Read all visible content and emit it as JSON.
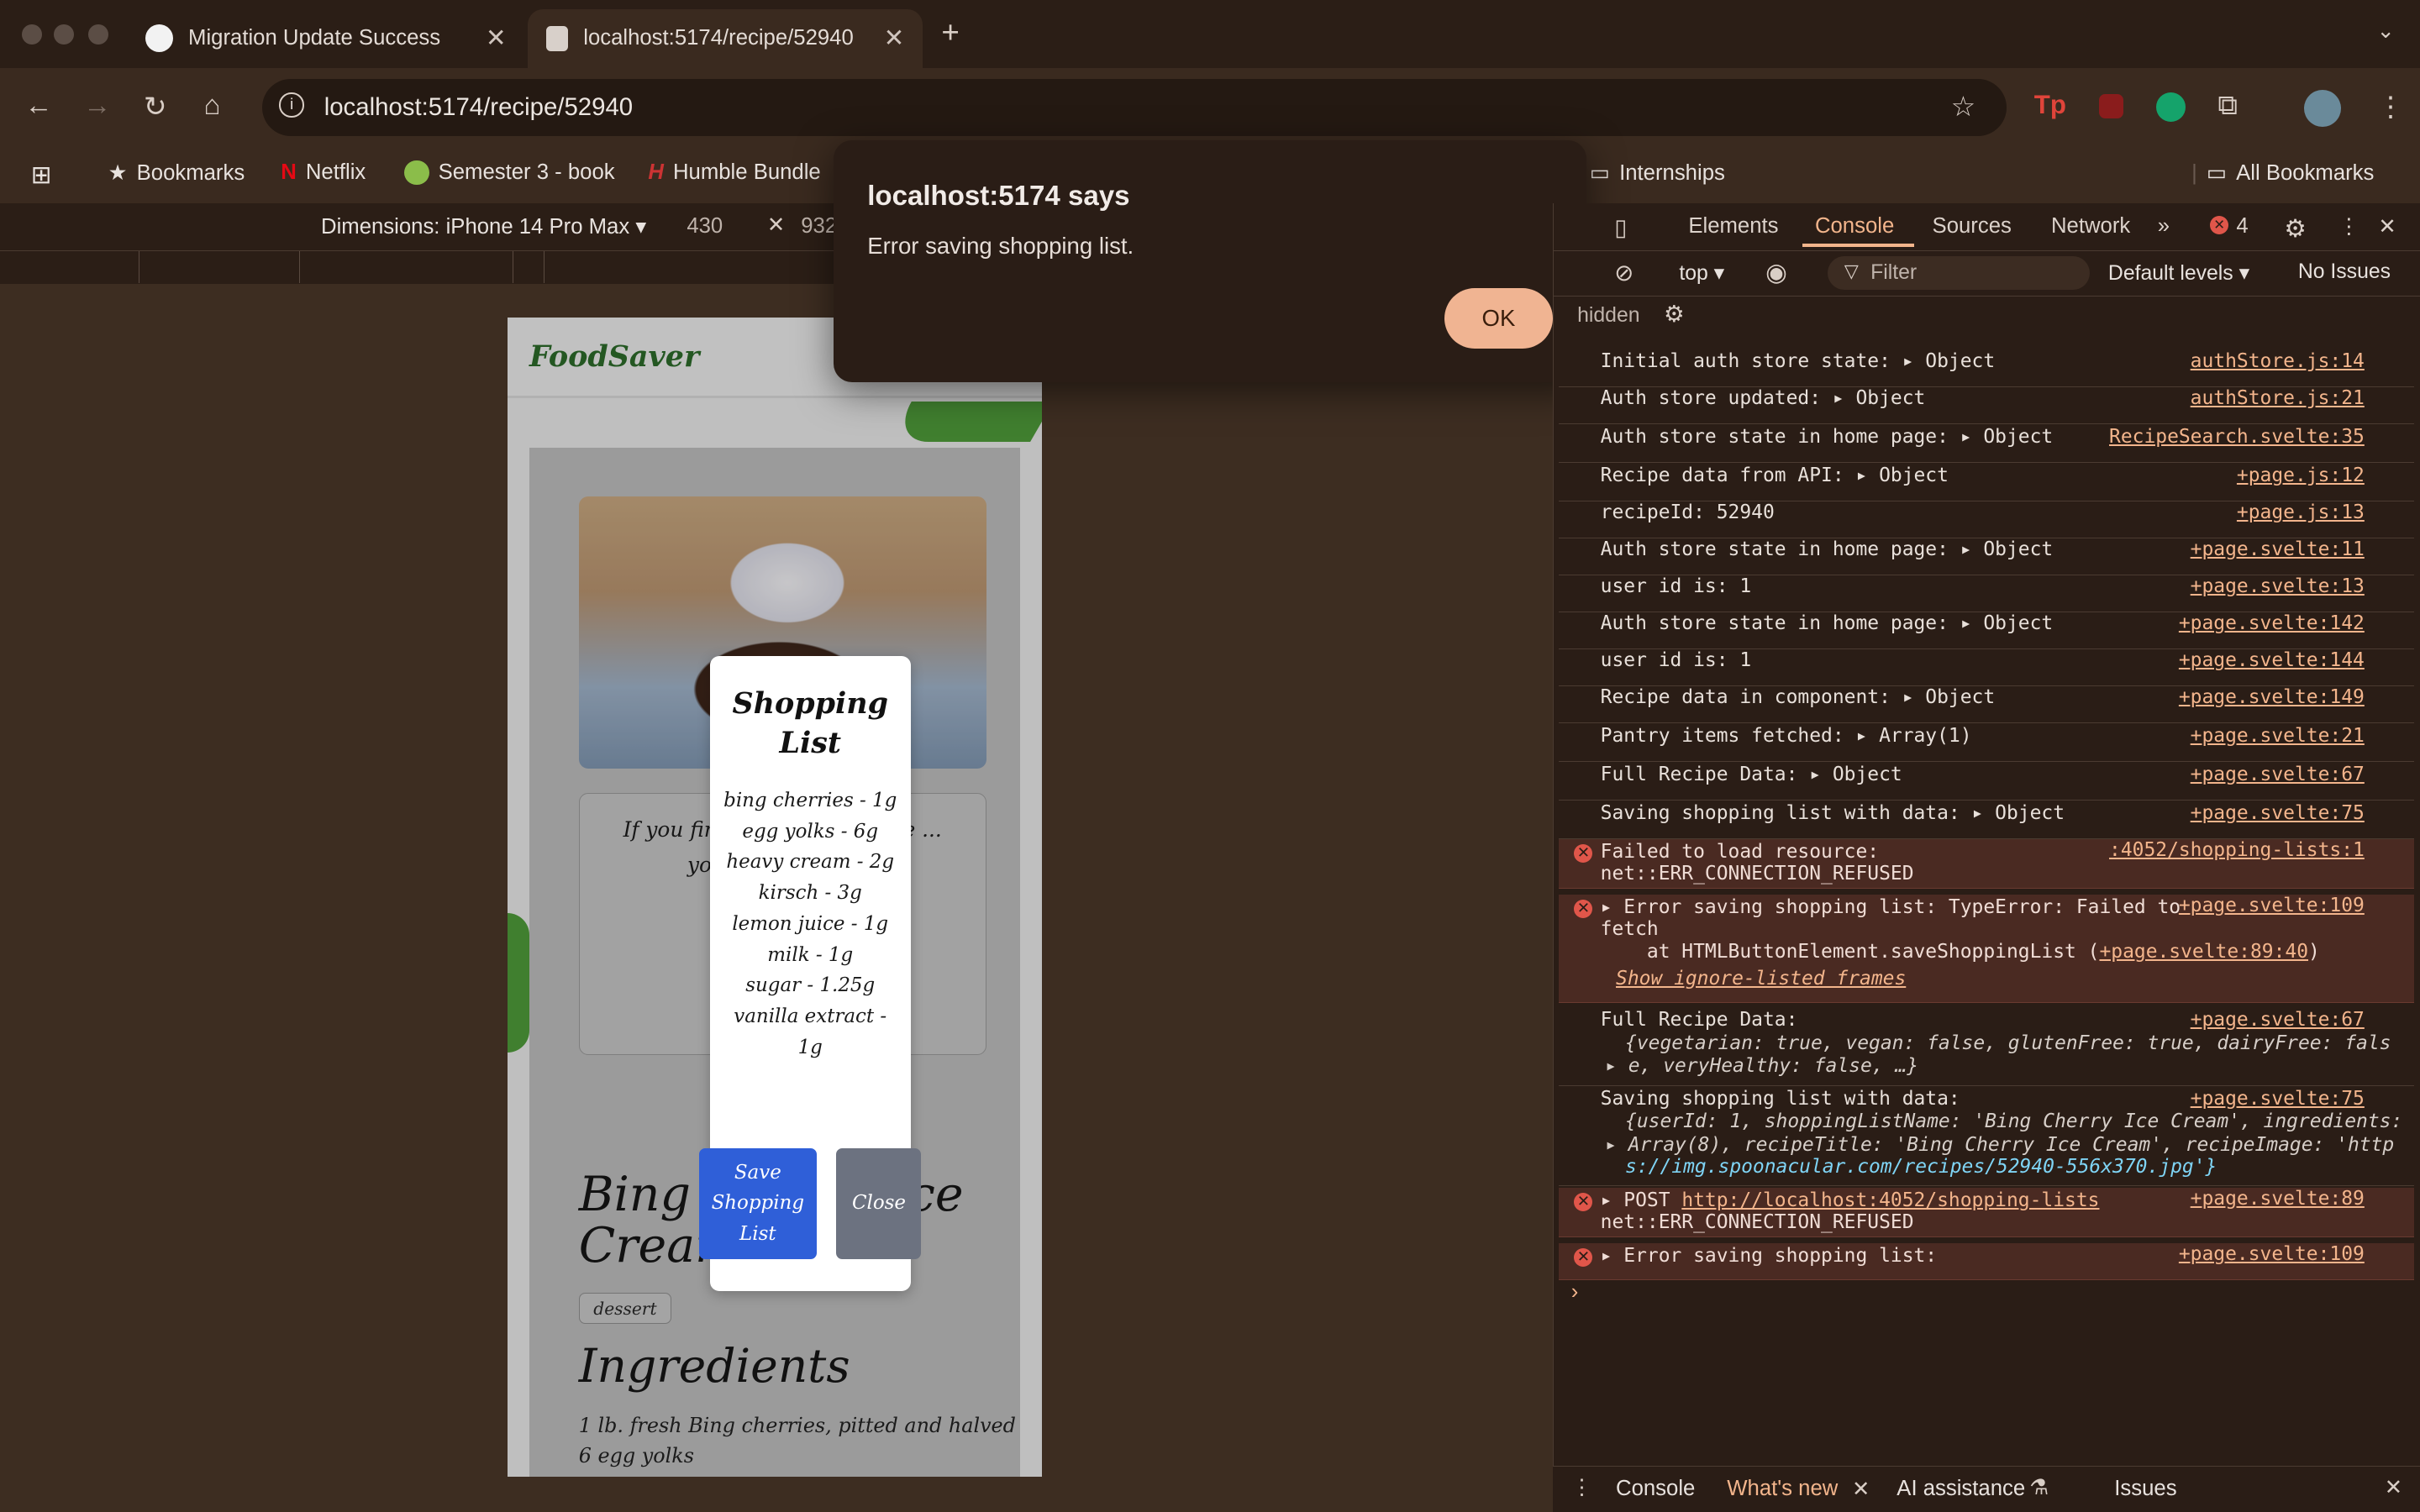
{
  "browser": {
    "tabs": [
      {
        "title": "Migration Update Success",
        "active": false
      },
      {
        "title": "localhost:5174/recipe/52940",
        "active": true
      }
    ],
    "url": "localhost:5174/recipe/52940",
    "bookmarks": [
      "Bookmarks",
      "Netflix",
      "Semester 3 - book",
      "Humble Bundle",
      "Internships",
      "All Bookmarks"
    ]
  },
  "device_toolbar": {
    "dimensions": "Dimensions: iPhone 14 Pro Max",
    "width": "430",
    "height": "932"
  },
  "alert": {
    "title": "localhost:5174 says",
    "message": "Error saving shopping list.",
    "ok": "OK"
  },
  "app": {
    "logo": "FoodSaver",
    "tip_text": "If you finish ... can click the ... your CO2 red... to",
    "recipe_title": "Bing Cherry Ice Cream",
    "badge": "dessert",
    "ingredients_heading": "Ingredients",
    "ingredients": [
      "1 lb. fresh Bing cherries, pitted and halved",
      "6 egg yolks"
    ],
    "modal": {
      "title": "Shopping List",
      "items": [
        "bing cherries - 1g",
        "egg yolks - 6g",
        "heavy cream - 2g",
        "kirsch - 3g",
        "lemon juice - 1g",
        "milk - 1g",
        "sugar - 1.25g",
        "vanilla extract - 1g"
      ],
      "save": "Save Shopping List",
      "close": "Close"
    }
  },
  "devtools": {
    "tabs": [
      "Elements",
      "Console",
      "Sources",
      "Network"
    ],
    "error_count": "4",
    "context": "top",
    "filter_placeholder": "Filter",
    "levels": "Default levels",
    "issues": "No Issues",
    "hidden": "hidden",
    "logs": [
      {
        "msg": "Initial auth store state:  ▸ Object",
        "src": "authStore.js:14"
      },
      {
        "msg": "Auth store updated:  ▸ Object",
        "src": "authStore.js:21"
      },
      {
        "msg": "Auth store state in home page:  ▸ Object",
        "src": "RecipeSearch.svelte:35"
      },
      {
        "msg": "Recipe data from API:  ▸ Object",
        "src": "+page.js:12"
      },
      {
        "msg": "recipeId: 52940",
        "src": "+page.js:13"
      },
      {
        "msg": "Auth store state in home page:  ▸ Object",
        "src": "+page.svelte:11"
      },
      {
        "msg": "user id is:  1",
        "src": "+page.svelte:13"
      },
      {
        "msg": "Auth store state in home page:  ▸ Object",
        "src": "+page.svelte:142"
      },
      {
        "msg": "user id is:  1",
        "src": "+page.svelte:144"
      },
      {
        "msg": "Recipe data in component:  ▸ Object",
        "src": "+page.svelte:149"
      },
      {
        "msg": "Pantry items fetched:  ▸ Array(1)",
        "src": "+page.svelte:21"
      },
      {
        "msg": "Full Recipe Data:  ▸ Object",
        "src": "+page.svelte:67"
      },
      {
        "msg": "Saving shopping list with data:  ▸ Object",
        "src": "+page.svelte:75"
      }
    ],
    "err1": {
      "line1": "Failed to load resource:",
      "line2": "net::ERR_CONNECTION_REFUSED",
      "src": ":4052/shopping-lists:1"
    },
    "err2": {
      "line1": "▸ Error saving shopping list: TypeError: Failed to",
      "line2": "fetch",
      "line3": "    at HTMLButtonElement.saveShoppingList (",
      "link": "+page.svelte:89:40",
      "line4": "Show ignore-listed frames",
      "src": "+page.svelte:109"
    },
    "full_recipe": {
      "label": "Full Recipe Data:",
      "src": "+page.svelte:67",
      "line1": "{vegetarian: true, vegan: false, glutenFree: true, dairyFree: fals",
      "line2": "▸ e, veryHealthy: false, …}"
    },
    "saving": {
      "label": "Saving shopping list with data:",
      "src": "+page.svelte:75",
      "line1": "{userId: 1, shoppingListName: 'Bing Cherry Ice Cream', ingredients:",
      "line2": "▸ Array(8), recipeTitle: 'Bing Cherry Ice Cream', recipeImage: 'http",
      "line3": "s://img.spoonacular.com/recipes/52940-556x370.jpg'}"
    },
    "err3": {
      "line1": "▸ POST",
      "url": "http://localhost:4052/shopping-lists",
      "line2": "net::ERR_CONNECTION_REFUSED",
      "src": "+page.svelte:89"
    },
    "err4": {
      "line1": "▸ Error saving shopping list:",
      "src": "+page.svelte:109"
    },
    "drawer_tabs": [
      "Console",
      "What's new",
      "AI assistance",
      "Issues"
    ]
  }
}
